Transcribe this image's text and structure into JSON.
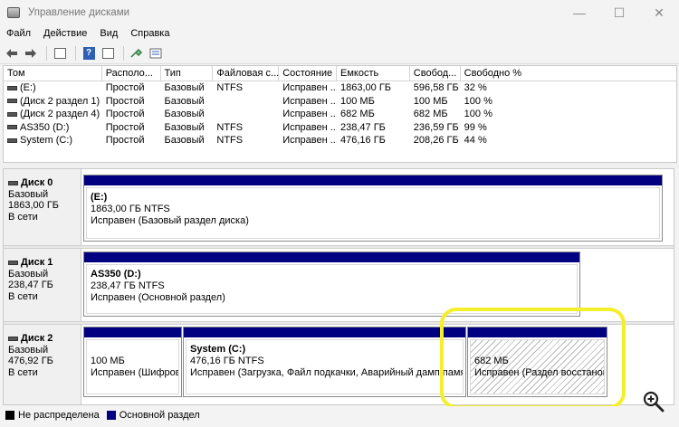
{
  "window": {
    "title": "Управление дисками",
    "minimize_icon": "—",
    "maximize_icon": "☐",
    "close_icon": "✕"
  },
  "menu": [
    "Файл",
    "Действие",
    "Вид",
    "Справка"
  ],
  "toolbar": [
    "back-icon",
    "forward-icon",
    "properties-icon",
    "help-icon",
    "refresh-icon",
    "list-view-icon"
  ],
  "table": {
    "columns": [
      "Том",
      "Располо...",
      "Тип",
      "Файловая с...",
      "Состояние",
      "Емкость",
      "Свобод...",
      "Свободно %"
    ],
    "rows": [
      [
        "(E:)",
        "Простой",
        "Базовый",
        "NTFS",
        "Исправен ...",
        "1863,00 ГБ",
        "596,58 ГБ",
        "32 %"
      ],
      [
        "(Диск 2 раздел 1)",
        "Простой",
        "Базовый",
        "",
        "Исправен ...",
        "100 МБ",
        "100 МБ",
        "100 %"
      ],
      [
        "(Диск 2 раздел 4)",
        "Простой",
        "Базовый",
        "",
        "Исправен ...",
        "682 МБ",
        "682 МБ",
        "100 %"
      ],
      [
        "AS350 (D:)",
        "Простой",
        "Базовый",
        "NTFS",
        "Исправен ...",
        "238,47 ГБ",
        "236,59 ГБ",
        "99 %"
      ],
      [
        "System (C:)",
        "Простой",
        "Базовый",
        "NTFS",
        "Исправен ...",
        "476,16 ГБ",
        "208,26 ГБ",
        "44 %"
      ]
    ]
  },
  "disks": [
    {
      "name": "Диск 0",
      "type": "Базовый",
      "size": "1863,00 ГБ",
      "status": "В сети",
      "partitions": [
        {
          "name": "(E:)",
          "info": "1863,00 ГБ NTFS",
          "status": "Исправен (Базовый раздел диска)"
        }
      ]
    },
    {
      "name": "Диск 1",
      "type": "Базовый",
      "size": "238,47 ГБ",
      "status": "В сети",
      "partitions": [
        {
          "name": "AS350  (D:)",
          "info": "238,47 ГБ NTFS",
          "status": "Исправен (Основной раздел)"
        }
      ]
    },
    {
      "name": "Диск 2",
      "type": "Базовый",
      "size": "476,92 ГБ",
      "status": "В сети",
      "partitions": [
        {
          "name": "",
          "info": "100 МБ",
          "status": "Исправен (Шифрова"
        },
        {
          "name": "System  (C:)",
          "info": "476,16 ГБ NTFS",
          "status": "Исправен (Загрузка, Файл подкачки, Аварийный дамп памяти, Е"
        },
        {
          "name": "",
          "info": "682 МБ",
          "status": "Исправен (Раздел восстановле"
        }
      ]
    }
  ],
  "legend": [
    {
      "label": "Не распределена",
      "color": "#000000"
    },
    {
      "label": "Основной раздел",
      "color": "#000080"
    }
  ],
  "colors": {
    "partition_header": "#000080",
    "highlight": "#f4ef2a"
  }
}
